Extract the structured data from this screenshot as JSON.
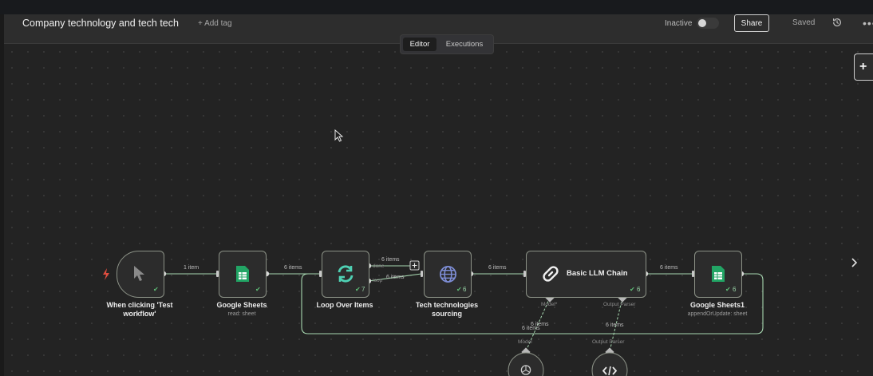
{
  "header": {
    "workflow_title": "Company technology and tech tech",
    "add_tag": "+ Add tag",
    "status_label": "Inactive",
    "share_label": "Share",
    "saved_label": "Saved",
    "more_label": "•••"
  },
  "tabs": {
    "editor": "Editor",
    "executions": "Executions"
  },
  "nodes": {
    "trigger": {
      "label_line1": "When clicking 'Test",
      "label_line2": "workflow'"
    },
    "sheets": {
      "label": "Google Sheets",
      "sub": "read: sheet"
    },
    "loop": {
      "label": "Loop Over Items",
      "count": "7"
    },
    "http": {
      "label_line1": "Tech technologies",
      "label_line2": "sourcing",
      "count": "6"
    },
    "llm": {
      "label": "Basic LLM Chain",
      "count": "6",
      "model_label": "Model*",
      "parser_label": "Output Parser"
    },
    "sheets1": {
      "label": "Google Sheets1",
      "sub": "appendOrUpdate: sheet",
      "count": "6"
    },
    "model": {
      "label": "Model"
    },
    "parser": {
      "label": "Output Parser"
    }
  },
  "connections": {
    "c1": "1 item",
    "c2": "6 items",
    "loop_done": "done",
    "loop_loop": "loop",
    "loop_top_count": "6 items",
    "loop_bottom_count": "6 items",
    "c3": "6 items",
    "c4": "6 items",
    "model_count": "6 items",
    "parser_count": "6 items",
    "back_count": "6 items"
  },
  "colors": {
    "canvas_bg": "#232323",
    "header_bg": "#2d2d2d",
    "node_bg": "#2c2c2c",
    "node_border": "#8b9186",
    "wire": "#a7d7b0",
    "success": "#5fbf77",
    "sheets_green": "#22a565",
    "loop_teal": "#4fd1b4",
    "http_blue": "#7f8fd8",
    "trigger_red": "#e04d3f"
  },
  "icons": {
    "trigger": "cursor-pointer-icon",
    "sheets": "spreadsheet-icon",
    "loop": "sync-icon",
    "http": "globe-icon",
    "llm": "link-chain-icon",
    "model": "openai-icon",
    "parser": "code-icon"
  }
}
